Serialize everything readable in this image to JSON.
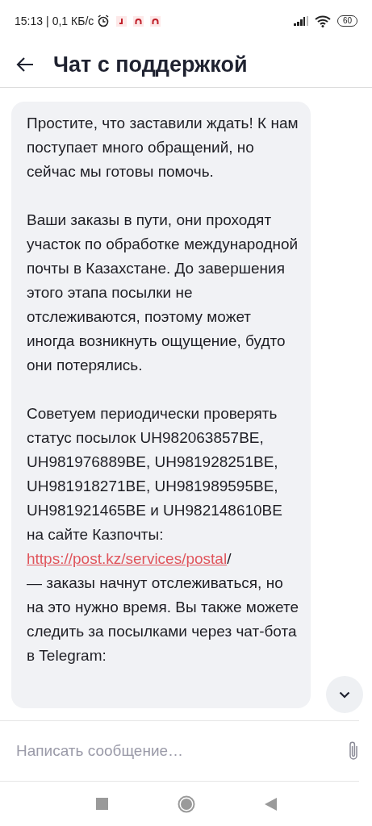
{
  "status_bar": {
    "time": "15:13",
    "separator": "|",
    "speed": "0,1 КБ/с",
    "battery": "60"
  },
  "header": {
    "title": "Чат с поддержкой"
  },
  "messages": [
    {
      "paragraphs": [
        {
          "text": "Простите, что заставили ждать! К нам поступает много обращений, но сейчас мы готовы помочь."
        },
        {
          "text": "Ваши заказы в пути, они проходят участок по обработке международной почты в Казахстане. До завершения этого этапа посылки не отслеживаются, поэтому может иногда возникнуть ощущение, будто они потерялись."
        },
        {
          "text": "Советуем периодически проверять статус посылок UH982063857BE, UH981976889BE, UH981928251BE, UH981918271BE, UH981989595BE, UH981921465BE и UH982148610BE на сайте Казпочты:",
          "link": "https://post.kz/services/postal",
          "after": "/\n— заказы начнут отслеживаться, но на это нужно время. Вы также можете следить за посылками через чат-бота в Telegram:"
        }
      ]
    }
  ],
  "composer": {
    "placeholder": "Написать сообщение…"
  }
}
